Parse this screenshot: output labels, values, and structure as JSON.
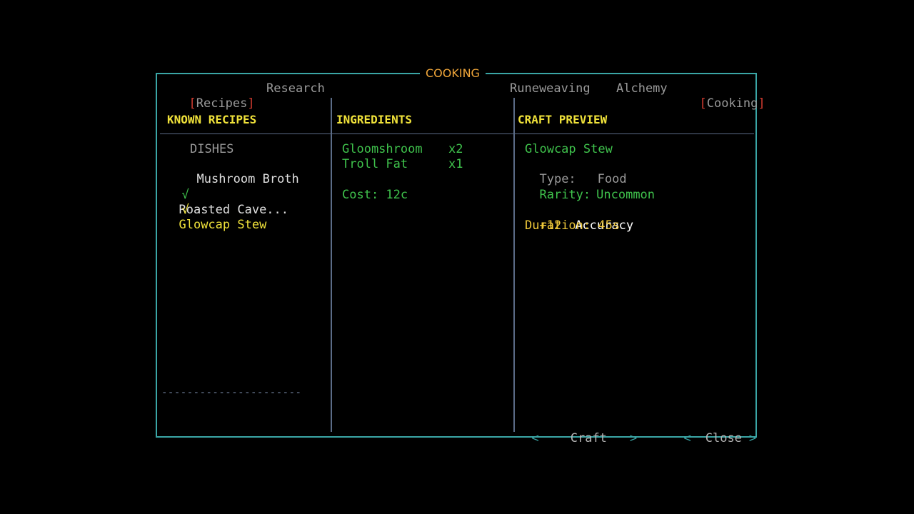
{
  "window": {
    "title": "COOKING"
  },
  "tabs": {
    "left": [
      {
        "label": "Recipes",
        "selected": true
      },
      {
        "label": "Research",
        "selected": false
      }
    ],
    "right": [
      {
        "label": "Runeweaving",
        "selected": false
      },
      {
        "label": "Alchemy",
        "selected": false
      },
      {
        "label": "Cooking",
        "selected": true
      }
    ]
  },
  "headers": {
    "known_recipes": "KNOWN RECIPES",
    "ingredients": "INGREDIENTS",
    "craft_preview": "CRAFT PREVIEW"
  },
  "recipes": {
    "category": "DISHES",
    "items": [
      {
        "name": "Mushroom Broth",
        "known": false,
        "mark": "",
        "selected": false
      },
      {
        "name": "Roasted Cave...",
        "known": true,
        "mark": "√",
        "selected": false
      },
      {
        "name": "Glowcap Stew",
        "known": true,
        "mark": "√",
        "selected": true
      }
    ],
    "divider": "----------------------"
  },
  "ingredients": {
    "items": [
      {
        "name": "Gloomshroom",
        "qty": "x2"
      },
      {
        "name": "Troll Fat",
        "qty": "x1"
      }
    ],
    "cost": "Cost: 12c"
  },
  "preview": {
    "name": "Glowcap Stew",
    "type_label": "Type:",
    "type_value": "Food",
    "rarity_label": "Rarity:",
    "rarity_value": "Uncommon",
    "bonus_value": "+12",
    "bonus_stat": "Accuracy",
    "duration": "Duration: 45s"
  },
  "actions": {
    "craft_label": "Craft",
    "close_label": "Close",
    "left_arrow": "<",
    "right_arrow": ">"
  },
  "colors": {
    "frame": "#3aa6a6",
    "title": "#f0a63a",
    "header": "#f0e23a",
    "selected_bracket": "#d43b30",
    "green_text": "#3fc24c",
    "highlight": "#f0e23a",
    "divider": "#5b6c87"
  }
}
